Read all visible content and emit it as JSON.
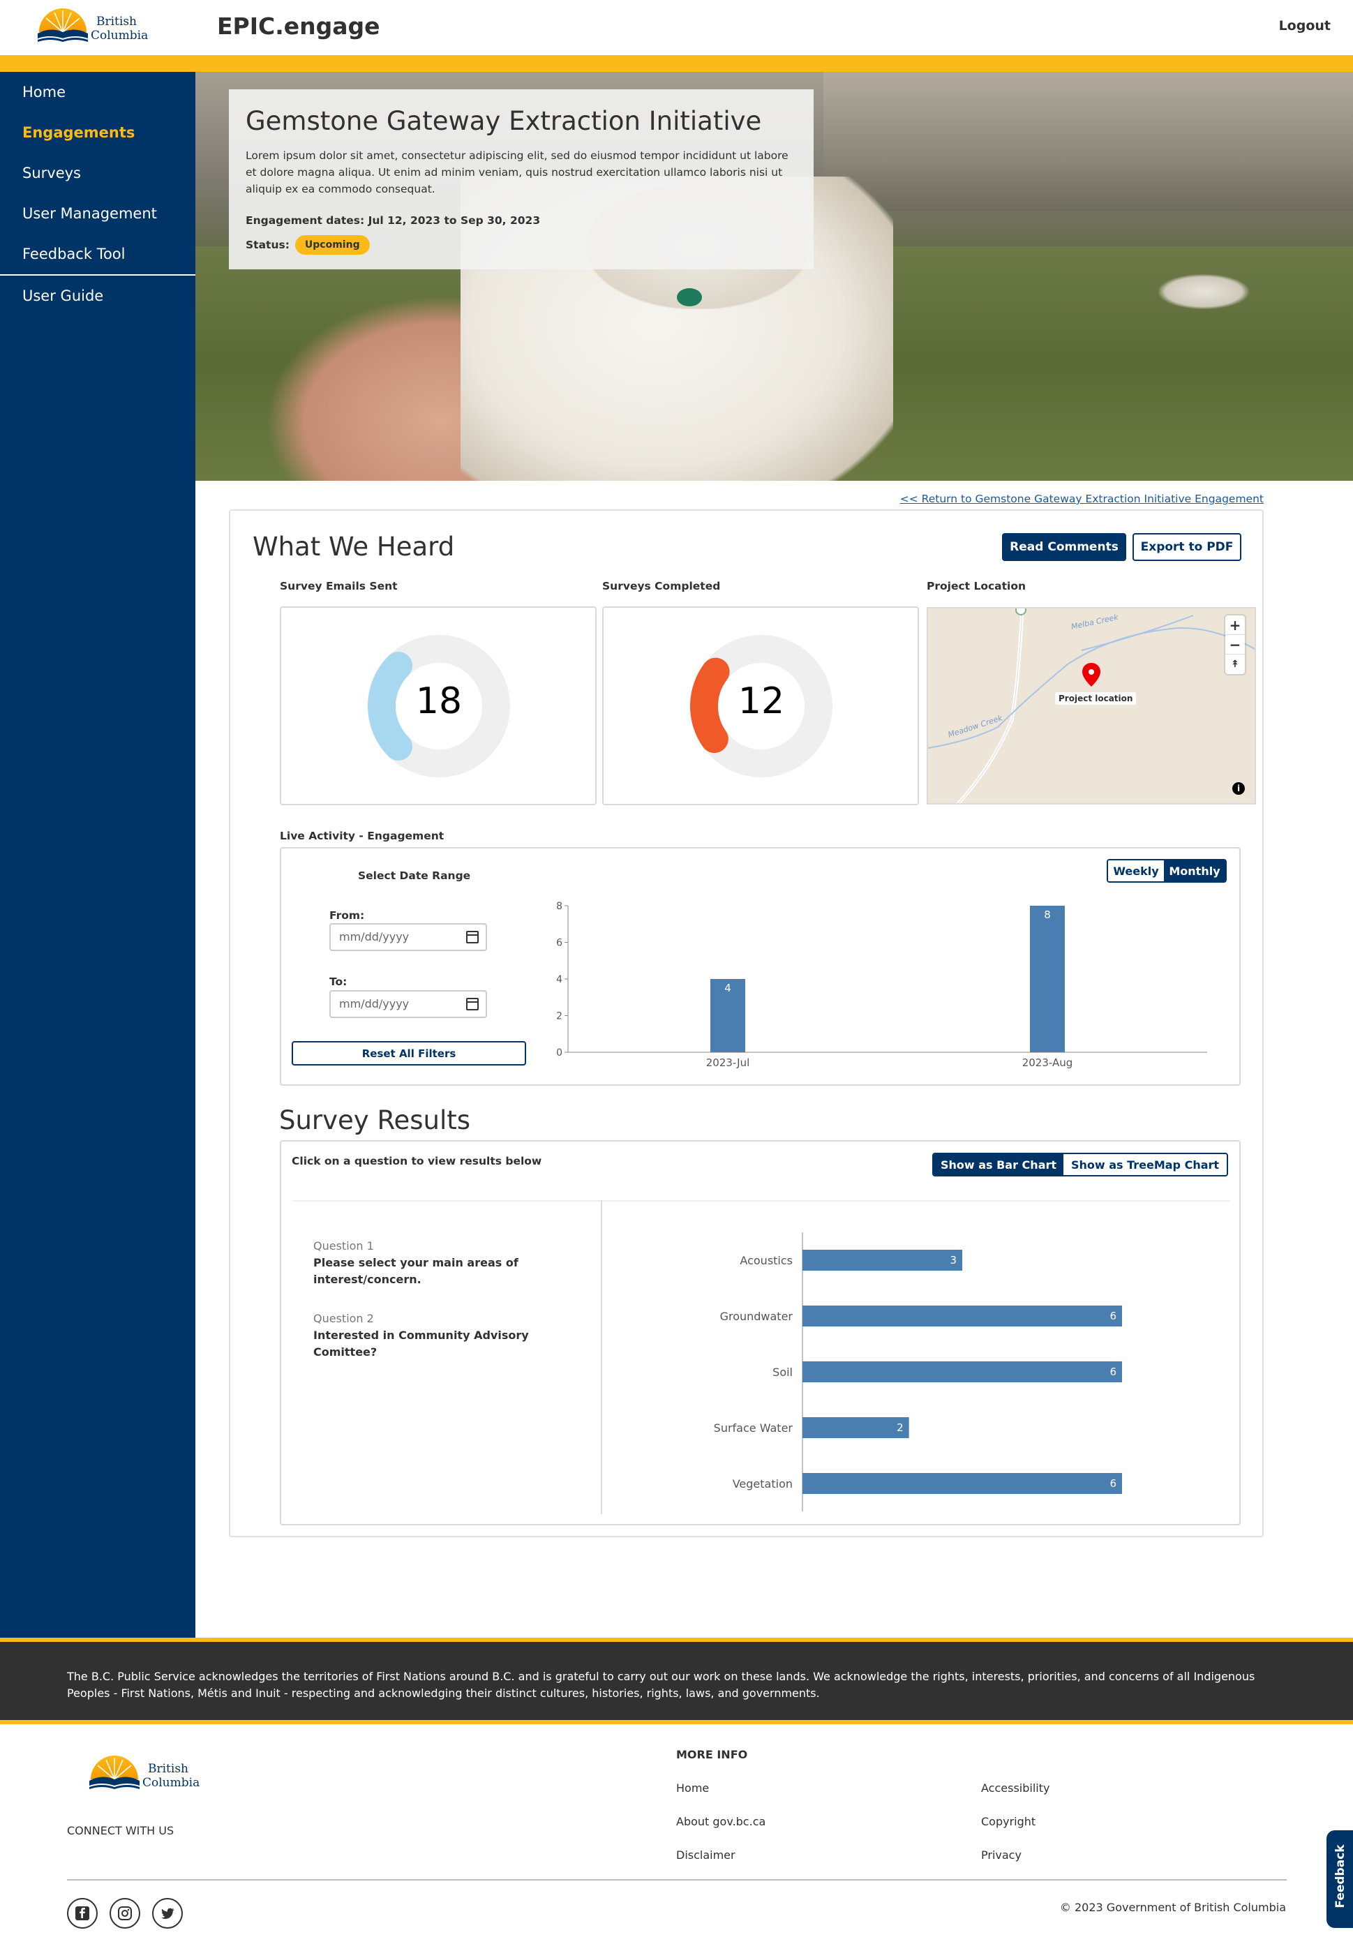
{
  "header": {
    "logo_line1": "British",
    "logo_line2": "Columbia",
    "app_title": "EPIC.engage",
    "logout": "Logout"
  },
  "sidebar": {
    "items": [
      {
        "label": "Home"
      },
      {
        "label": "Engagements"
      },
      {
        "label": "Surveys"
      },
      {
        "label": "User Management"
      },
      {
        "label": "Feedback Tool"
      },
      {
        "label": "User Guide"
      }
    ]
  },
  "hero": {
    "title": "Gemstone Gateway Extraction Initiative",
    "description": "Lorem ipsum dolor sit amet, consectetur adipiscing elit, sed do eiusmod tempor incididunt ut labore et dolore magna aliqua. Ut enim ad minim veniam, quis nostrud exercitation ullamco laboris nisi ut aliquip ex ea commodo consequat.",
    "dates": "Engagement dates: Jul 12, 2023 to Sep 30, 2023",
    "status_label": "Status:",
    "status_value": "Upcoming"
  },
  "return_link": "<< Return to Gemstone Gateway Extraction Initiative Engagement",
  "report": {
    "title": "What We Heard",
    "read_comments": "Read Comments",
    "export_pdf": "Export to PDF",
    "emails_label": "Survey Emails Sent",
    "emails_value": "18",
    "emails_fraction": 0.25,
    "emails_color": "#a8d8f0",
    "completed_label": "Surveys Completed",
    "completed_value": "12",
    "completed_fraction": 0.2,
    "completed_color": "#f05a28",
    "location_label": "Project Location",
    "map": {
      "zoom_in": "+",
      "zoom_out": "−",
      "compass": "↟",
      "marker_label": "Project location",
      "creek1": "Melba Creek",
      "creek2": "Meadow Creek",
      "info": "i"
    }
  },
  "activity": {
    "label": "Live Activity - Engagement",
    "select_range": "Select Date Range",
    "from_label": "From:",
    "to_label": "To:",
    "date_placeholder": "mm/dd/yyyy",
    "reset": "Reset All Filters",
    "weekly": "Weekly",
    "monthly": "Monthly",
    "chart_data": {
      "type": "bar",
      "categories": [
        "2023-Jul",
        "2023-Aug"
      ],
      "values": [
        4,
        8
      ],
      "yticks": [
        "0",
        "2",
        "4",
        "6",
        "8"
      ],
      "ylim": [
        0,
        8
      ]
    }
  },
  "survey_results": {
    "title": "Survey Results",
    "instructions": "Click on a question to view results below",
    "bar_chart_btn": "Show as Bar Chart",
    "treemap_btn": "Show as TreeMap Chart",
    "questions": [
      {
        "num": "Question 1",
        "text": "Please select your main areas of interest/concern."
      },
      {
        "num": "Question 2",
        "text": "Interested in Community Advisory Comittee?"
      }
    ],
    "chart_data": {
      "type": "bar",
      "categories": [
        "Acoustics",
        "Groundwater",
        "Soil",
        "Surface Water",
        "Vegetation"
      ],
      "values": [
        3,
        6,
        6,
        2,
        6
      ]
    }
  },
  "footer": {
    "acknowledgement": "The B.C. Public Service acknowledges the territories of First Nations around B.C. and is grateful to carry out our work on these lands. We acknowledge the rights, interests, priorities, and concerns of all Indigenous Peoples - First Nations, Métis and Inuit - respecting and acknowledging their distinct cultures, histories, rights, laws, and governments.",
    "connect": "CONNECT WITH US",
    "more_info": "MORE INFO",
    "links_left": [
      "Home",
      "About gov.bc.ca",
      "Disclaimer"
    ],
    "links_right": [
      "Accessibility",
      "Copyright",
      "Privacy"
    ],
    "copyright": "© 2023 Government of British Columbia",
    "feedback": "Feedback"
  }
}
